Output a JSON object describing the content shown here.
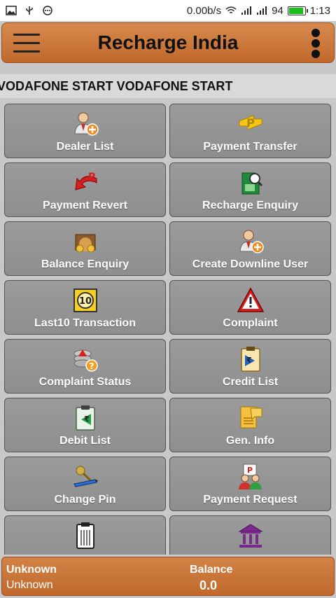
{
  "status_bar": {
    "speed": "0.00b/s",
    "battery": "94",
    "battery_level": 0.94,
    "time": "1:13",
    "icons": [
      "image-icon",
      "usb-icon",
      "chat-icon",
      "wifi-icon",
      "signal-icon",
      "signal-icon",
      "battery-icon"
    ]
  },
  "app_bar": {
    "title": "Recharge India",
    "menu_icon": "hamburger-icon",
    "overflow_icon": "more-vert-icon"
  },
  "marquee": {
    "text": "VODAFONE START VODAFONE START"
  },
  "tiles": [
    {
      "label": "Dealer List",
      "icon": "add-user-icon"
    },
    {
      "label": "Payment Transfer",
      "icon": "transfer-icon"
    },
    {
      "label": "Payment Revert",
      "icon": "revert-icon"
    },
    {
      "label": "Recharge Enquiry",
      "icon": "sim-search-icon"
    },
    {
      "label": "Balance Enquiry",
      "icon": "money-bag-icon"
    },
    {
      "label": "Create Downline User",
      "icon": "add-user-icon"
    },
    {
      "label": "Last10 Transaction",
      "icon": "ten-badge-icon"
    },
    {
      "label": "Complaint",
      "icon": "warning-icon"
    },
    {
      "label": "Complaint Status",
      "icon": "coins-warning-icon"
    },
    {
      "label": "Credit List",
      "icon": "clipboard-credit-icon"
    },
    {
      "label": "Debit List",
      "icon": "clipboard-debit-icon"
    },
    {
      "label": "Gen. Info",
      "icon": "info-sheet-icon"
    },
    {
      "label": "Change Pin",
      "icon": "key-pen-icon"
    },
    {
      "label": "Payment Request",
      "icon": "users-request-icon"
    },
    {
      "label": "",
      "icon": "clipboard-list-icon"
    },
    {
      "label": "",
      "icon": "bank-icon"
    }
  ],
  "footer": {
    "name": "Unknown",
    "subtitle": "Unknown",
    "balance_label": "Balance",
    "balance_value": "0.0"
  },
  "colors": {
    "appbar": "#c8773a",
    "tile": "#959595",
    "background": "#c8c8c8",
    "footer": "#c8773a"
  }
}
